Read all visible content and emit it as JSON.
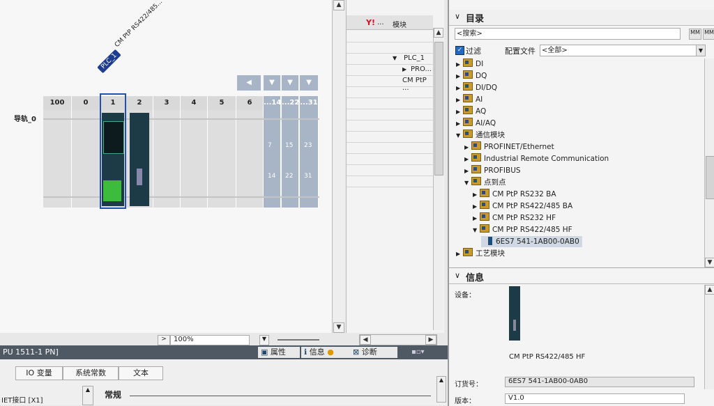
{
  "rack": {
    "rail_label": "导轨_0",
    "plc_tag": "PLC_1",
    "module_tag": "CM PtP RS422/485...",
    "slot_numbers": [
      "100",
      "0",
      "1",
      "2",
      "3",
      "4",
      "5",
      "6"
    ],
    "ext_headers": [
      "...14",
      "...22",
      "...31"
    ],
    "ext_row1": [
      "7",
      "15",
      "23"
    ],
    "ext_row2": [
      "14",
      "22",
      "31"
    ],
    "zoom": "100%"
  },
  "overview": {
    "col_header": "模块",
    "items": [
      {
        "label": "PLC_1",
        "indent": 0,
        "arrow": "▼"
      },
      {
        "label": "PRO...",
        "indent": 1,
        "arrow": "▶"
      },
      {
        "label": "CM PtP ...",
        "indent": 1,
        "arrow": ""
      }
    ]
  },
  "catalog": {
    "title": "目录",
    "search_placeholder": "<搜索>",
    "filter_label": "过滤",
    "profile_label": "配置文件",
    "profile_value": "<全部>",
    "tree": [
      {
        "label": "DI",
        "level": 0,
        "arrow": "▶",
        "type": "folder"
      },
      {
        "label": "DQ",
        "level": 0,
        "arrow": "▶",
        "type": "folder"
      },
      {
        "label": "DI/DQ",
        "level": 0,
        "arrow": "▶",
        "type": "folder"
      },
      {
        "label": "AI",
        "level": 0,
        "arrow": "▶",
        "type": "folder"
      },
      {
        "label": "AQ",
        "level": 0,
        "arrow": "▶",
        "type": "folder"
      },
      {
        "label": "AI/AQ",
        "level": 0,
        "arrow": "▶",
        "type": "folder"
      },
      {
        "label": "通信模块",
        "level": 0,
        "arrow": "▼",
        "type": "folder"
      },
      {
        "label": "PROFINET/Ethernet",
        "level": 1,
        "arrow": "▶",
        "type": "folder"
      },
      {
        "label": "Industrial Remote Communication",
        "level": 1,
        "arrow": "▶",
        "type": "folder"
      },
      {
        "label": "PROFIBUS",
        "level": 1,
        "arrow": "▶",
        "type": "folder"
      },
      {
        "label": "点到点",
        "level": 1,
        "arrow": "▼",
        "type": "folder"
      },
      {
        "label": "CM PtP RS232 BA",
        "level": 2,
        "arrow": "▶",
        "type": "folder"
      },
      {
        "label": "CM PtP RS422/485 BA",
        "level": 2,
        "arrow": "▶",
        "type": "folder"
      },
      {
        "label": "CM PtP RS232 HF",
        "level": 2,
        "arrow": "▶",
        "type": "folder"
      },
      {
        "label": "CM PtP RS422/485 HF",
        "level": 2,
        "arrow": "▼",
        "type": "folder"
      },
      {
        "label": "6ES7 541-1AB00-0AB0",
        "level": 3,
        "arrow": "",
        "type": "module",
        "selected": true
      },
      {
        "label": "工艺模块",
        "level": 0,
        "arrow": "▶",
        "type": "folder"
      }
    ]
  },
  "info": {
    "title": "信息",
    "device_label": "设备：",
    "device_name": "CM PtP RS422/485 HF",
    "order_label": "订货号：",
    "order_value": "6ES7 541-1AB00-0AB0",
    "version_label": "版本：",
    "version_value": "V1.0"
  },
  "props": {
    "device_title": "PU 1511-1 PN]",
    "tab_props": "属性",
    "tab_info": "信息",
    "tab_diag": "诊断",
    "subtabs": [
      "IO 变量",
      "系统常数",
      "文本"
    ],
    "left_item": "IET接口 [X1]",
    "section": "常规"
  }
}
